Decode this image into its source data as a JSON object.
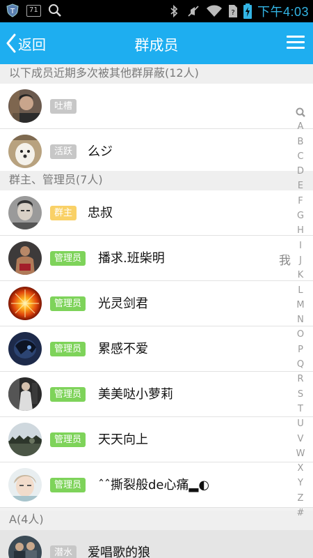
{
  "status_bar": {
    "badge_text": "71",
    "time": "下午4:03",
    "icons": [
      "shield-icon",
      "message-icon",
      "search-icon",
      "bluetooth-icon",
      "mute-icon",
      "wifi-icon",
      "sim-icon",
      "battery-icon"
    ]
  },
  "header": {
    "back_label": "返回",
    "title": "群成员",
    "menu_icon": "hamburger-menu-icon"
  },
  "sections": {
    "blocked": "以下成员近期多次被其他群屏蔽(12人)",
    "admins": "群主、管理员(7人)",
    "a": "A(4人)"
  },
  "members": [
    {
      "badge": "吐槽",
      "name": "",
      "me": ""
    },
    {
      "badge": "活跃",
      "name": "么ジ",
      "me": ""
    },
    {
      "badge": "群主",
      "name": "忠叔",
      "me": ""
    },
    {
      "badge": "管理员",
      "name": "播求.班柴明",
      "me": "我"
    },
    {
      "badge": "管理员",
      "name": "光灵剑君",
      "me": ""
    },
    {
      "badge": "管理员",
      "name": "累感不爱",
      "me": ""
    },
    {
      "badge": "管理员",
      "name": "美美哒小萝莉",
      "me": ""
    },
    {
      "badge": "管理员",
      "name": "天天向上",
      "me": ""
    },
    {
      "badge": "管理员",
      "name": "ˆˆ撕裂般de心痛▂◐",
      "me": ""
    },
    {
      "badge": "潜水",
      "name": "爱唱歌的狼",
      "me": ""
    }
  ],
  "index_bar": {
    "search_icon": "search-icon",
    "letters": [
      "A",
      "B",
      "C",
      "D",
      "E",
      "F",
      "G",
      "H",
      "I",
      "J",
      "K",
      "L",
      "M",
      "N",
      "O",
      "P",
      "Q",
      "R",
      "S",
      "T",
      "U",
      "V",
      "W",
      "X",
      "Y",
      "Z",
      "#"
    ]
  },
  "colors": {
    "accent": "#1eaef0",
    "badge_admin": "#7ed35a",
    "badge_owner": "#f9d167",
    "badge_other": "#c7c7c7",
    "time": "#33b5e5"
  }
}
